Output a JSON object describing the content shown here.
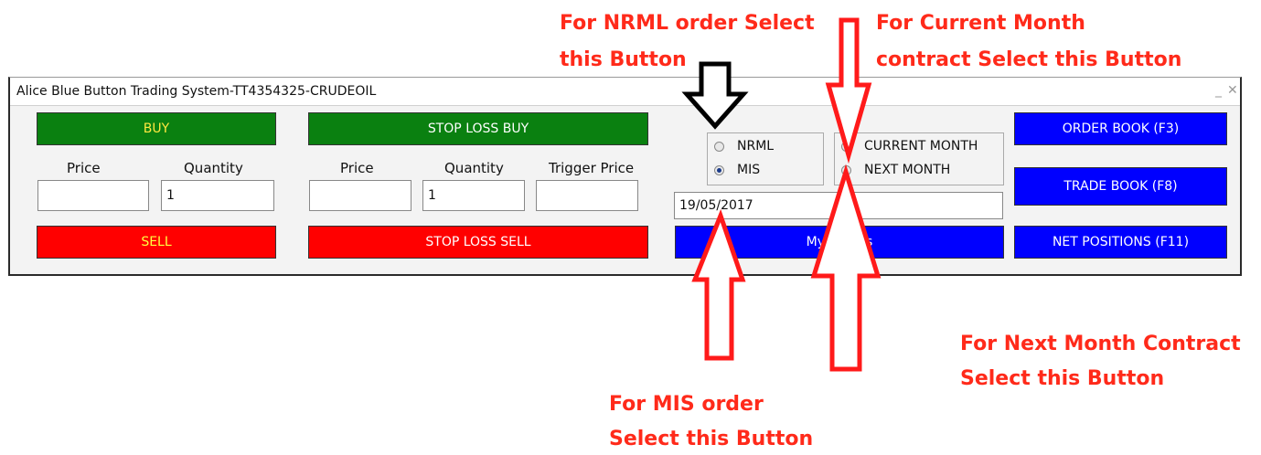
{
  "annotations": {
    "nrml_line1": "For NRML order Select",
    "nrml_line2": "this Button",
    "current_line1": "For Current Month",
    "current_line2": "contract Select this Button",
    "next_line1": "For Next Month Contract",
    "next_line2": "Select this Button",
    "mis_line1": "For MIS order",
    "mis_line2": "Select this Button"
  },
  "window": {
    "title": "Alice Blue Button Trading System-TT4354325-CRUDEOIL",
    "minimize": "_",
    "close": "✕"
  },
  "left": {
    "buy": "BUY",
    "sell": "SELL",
    "price_label": "Price",
    "quantity_label": "Quantity",
    "price_value": "",
    "quantity_value": "1"
  },
  "stoploss": {
    "buy": "STOP LOSS BUY",
    "sell": "STOP LOSS SELL",
    "price_label": "Price",
    "quantity_label": "Quantity",
    "trigger_label": "Trigger Price",
    "price_value": "",
    "quantity_value": "1",
    "trigger_value": ""
  },
  "product": {
    "nrml": "NRML",
    "mis": "MIS",
    "selected": "MIS"
  },
  "contract": {
    "current": "CURRENT MONTH",
    "next": "NEXT MONTH",
    "selected": "CURRENT MONTH"
  },
  "date_value": "19/05/2017",
  "my_clients": "My Clients",
  "right": {
    "order_book": "ORDER BOOK (F3)",
    "trade_book": "TRADE BOOK (F8)",
    "net_positions": "NET POSITIONS (F11)"
  }
}
